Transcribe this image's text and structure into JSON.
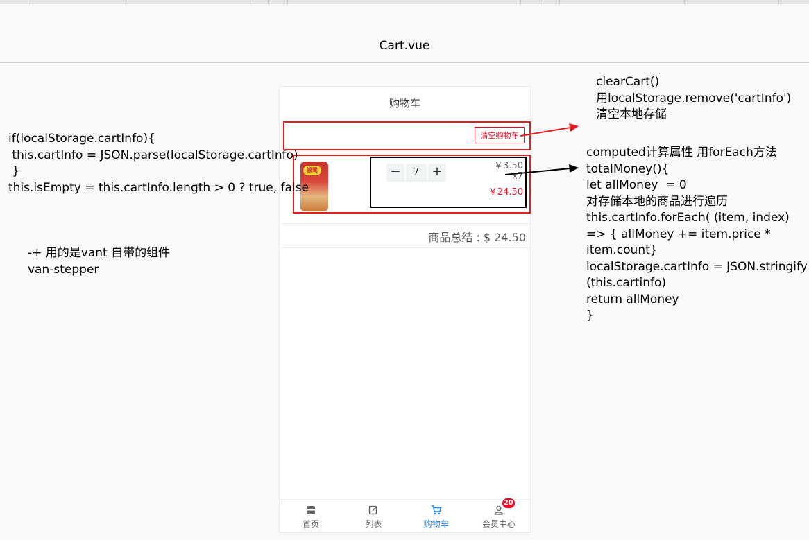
{
  "document": {
    "title": "Cart.vue"
  },
  "phone": {
    "nav_title": "购物车",
    "clear_button": "清空购物车",
    "product": {
      "image_label": "银鹭",
      "price": "￥3.50",
      "quantity": "x7",
      "subtotal": "￥24.50",
      "count": "7",
      "minus": "−",
      "plus": "+"
    },
    "total": "商品总结 : $ 24.50",
    "tabbar": [
      {
        "label": "首页",
        "icon": "home-icon"
      },
      {
        "label": "列表",
        "icon": "list-icon"
      },
      {
        "label": "购物车",
        "icon": "cart-icon"
      },
      {
        "label": "会员中心",
        "icon": "user-icon",
        "badge": "20"
      }
    ]
  },
  "notes": {
    "left_code": "if(localStorage.cartInfo){\n this.cartInfo = JSON.parse(localStorage.cartInfo)\n }\nthis.isEmpty = this.cartInfo.length > 0 ? true, false",
    "stepper_note": "-+ 用的是vant 自带的组件\nvan-stepper",
    "clear_note": "clearCart()\n用localStorage.remove('cartInfo')\n清空本地存储",
    "computed_note": "computed计算属性 用forEach方法\ntotalMoney(){\nlet allMoney  = 0\n对存储本地的商品进行遍历\nthis.cartInfo.forEach( (item, index)\n=> { allMoney += item.price *\nitem.count}\nlocalStorage.cartInfo = JSON.stringify\n(this.cartinfo)\nreturn allMoney\n}"
  },
  "colors": {
    "accent_red": "#ee0a24",
    "active_blue": "#1989fa",
    "annotation_red": "#e02020"
  }
}
